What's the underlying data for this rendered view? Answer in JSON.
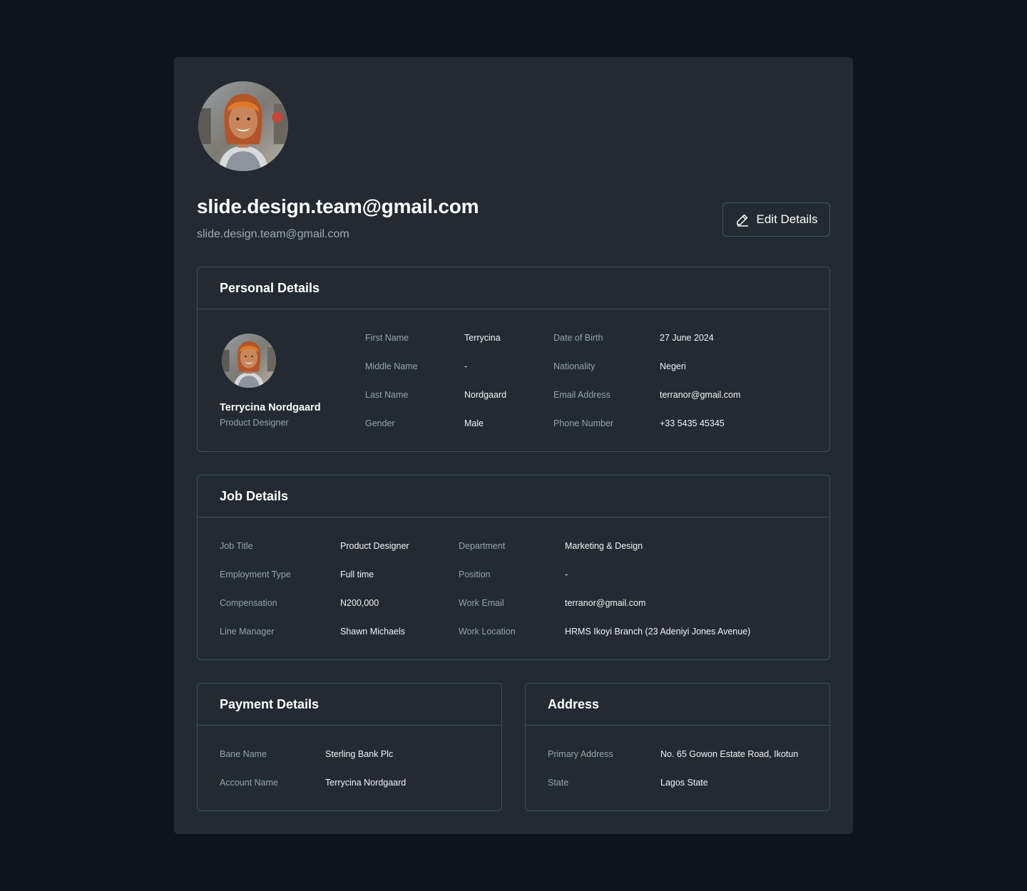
{
  "profile": {
    "title": "slide.design.team@gmail.com",
    "subtitle": "slide.design.team@gmail.com",
    "edit_label": "Edit Details"
  },
  "personal": {
    "heading": "Personal Details",
    "name": "Terrycina Nordgaard",
    "role": "Product Designer",
    "fields": [
      {
        "label": "First Name",
        "value": "Terrycina"
      },
      {
        "label": "Middle Name",
        "value": "-"
      },
      {
        "label": "Last Name",
        "value": "Nordgaard"
      },
      {
        "label": "Gender",
        "value": "Male"
      },
      {
        "label": "Date of Birth",
        "value": "27 June 2024"
      },
      {
        "label": "Nationality",
        "value": "Negeri"
      },
      {
        "label": "Email Address",
        "value": "terranor@gmail.com"
      },
      {
        "label": "Phone Number",
        "value": "+33 5435 45345"
      }
    ]
  },
  "job": {
    "heading": "Job Details",
    "fields": [
      {
        "label": "Job Title",
        "value": "Product Designer"
      },
      {
        "label": "Employment Type",
        "value": "Full time"
      },
      {
        "label": "Compensation",
        "value": "N200,000"
      },
      {
        "label": "Line Manager",
        "value": "Shawn Michaels"
      },
      {
        "label": "Department",
        "value": "Marketing & Design"
      },
      {
        "label": "Position",
        "value": "-"
      },
      {
        "label": "Work Email",
        "value": "terranor@gmail.com"
      },
      {
        "label": "Work Location",
        "value": "HRMS Ikoyi Branch (23 Adeniyi Jones Avenue)"
      }
    ]
  },
  "payment": {
    "heading": "Payment Details",
    "fields": [
      {
        "label": "Bane Name",
        "value": "Sterling Bank Plc"
      },
      {
        "label": "Account Name",
        "value": "Terrycina Nordgaard"
      }
    ]
  },
  "address": {
    "heading": "Address",
    "fields": [
      {
        "label": "Primary Address",
        "value": "No. 65 Gowon Estate Road, Ikotun"
      },
      {
        "label": "State",
        "value": "Lagos State"
      }
    ]
  },
  "icons": {
    "edit": "pencil-edit-icon",
    "avatar": "avatar-photo"
  },
  "colors": {
    "page_bg": "#0f131c",
    "card_bg": "#232a31",
    "border": "#434b54",
    "label": "#9aa2aa",
    "value": "#f2f4f6"
  }
}
